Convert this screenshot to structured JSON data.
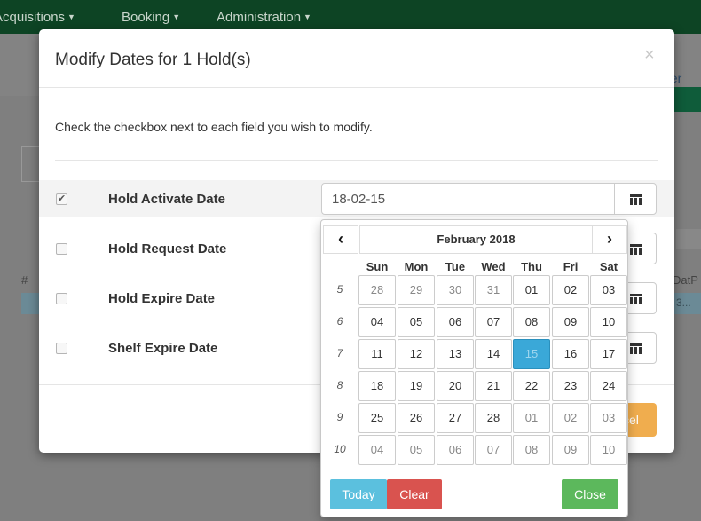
{
  "navbar": {
    "items": [
      {
        "label": "Acquisitions"
      },
      {
        "label": "Booking"
      },
      {
        "label": "Administration"
      }
    ]
  },
  "background": {
    "partial_link": "her",
    "table_header_left": "#",
    "table_header_right": "DatP",
    "row_text": "3..."
  },
  "modal": {
    "title": "Modify Dates for 1 Hold(s)",
    "close_glyph": "×",
    "instructions": "Check the checkbox next to each field you wish to modify.",
    "fields": [
      {
        "label": "Hold Activate Date",
        "checked": true,
        "value": "18-02-15"
      },
      {
        "label": "Hold Request Date",
        "checked": false,
        "value": ""
      },
      {
        "label": "Hold Expire Date",
        "checked": false,
        "value": ""
      },
      {
        "label": "Shelf Expire Date",
        "checked": false,
        "value": ""
      }
    ],
    "cancel_partial": "cel"
  },
  "datepicker": {
    "month_label": "February 2018",
    "prev_glyph": "‹",
    "next_glyph": "›",
    "weekdays": [
      "Sun",
      "Mon",
      "Tue",
      "Wed",
      "Thu",
      "Fri",
      "Sat"
    ],
    "weeks": [
      {
        "num": "5",
        "days": [
          "28",
          "29",
          "30",
          "31",
          "01",
          "02",
          "03"
        ],
        "muted": [
          true,
          true,
          true,
          true,
          false,
          false,
          false
        ]
      },
      {
        "num": "6",
        "days": [
          "04",
          "05",
          "06",
          "07",
          "08",
          "09",
          "10"
        ],
        "muted": [
          false,
          false,
          false,
          false,
          false,
          false,
          false
        ]
      },
      {
        "num": "7",
        "days": [
          "11",
          "12",
          "13",
          "14",
          "15",
          "16",
          "17"
        ],
        "muted": [
          false,
          false,
          false,
          false,
          false,
          false,
          false
        ]
      },
      {
        "num": "8",
        "days": [
          "18",
          "19",
          "20",
          "21",
          "22",
          "23",
          "24"
        ],
        "muted": [
          false,
          false,
          false,
          false,
          false,
          false,
          false
        ]
      },
      {
        "num": "9",
        "days": [
          "25",
          "26",
          "27",
          "28",
          "01",
          "02",
          "03"
        ],
        "muted": [
          false,
          false,
          false,
          false,
          true,
          true,
          true
        ]
      },
      {
        "num": "10",
        "days": [
          "04",
          "05",
          "06",
          "07",
          "08",
          "09",
          "10"
        ],
        "muted": [
          true,
          true,
          true,
          true,
          true,
          true,
          true
        ]
      }
    ],
    "selected_day": "15",
    "buttons": {
      "today": "Today",
      "clear": "Clear",
      "close": "Close"
    }
  },
  "colors": {
    "navbar": "#0d4424",
    "selected_day": "#3aa8d8",
    "today_button": "#5bc0de",
    "clear_button": "#d9534f",
    "close_button": "#5cb85c",
    "cancel_button": "#f0ad4e"
  }
}
